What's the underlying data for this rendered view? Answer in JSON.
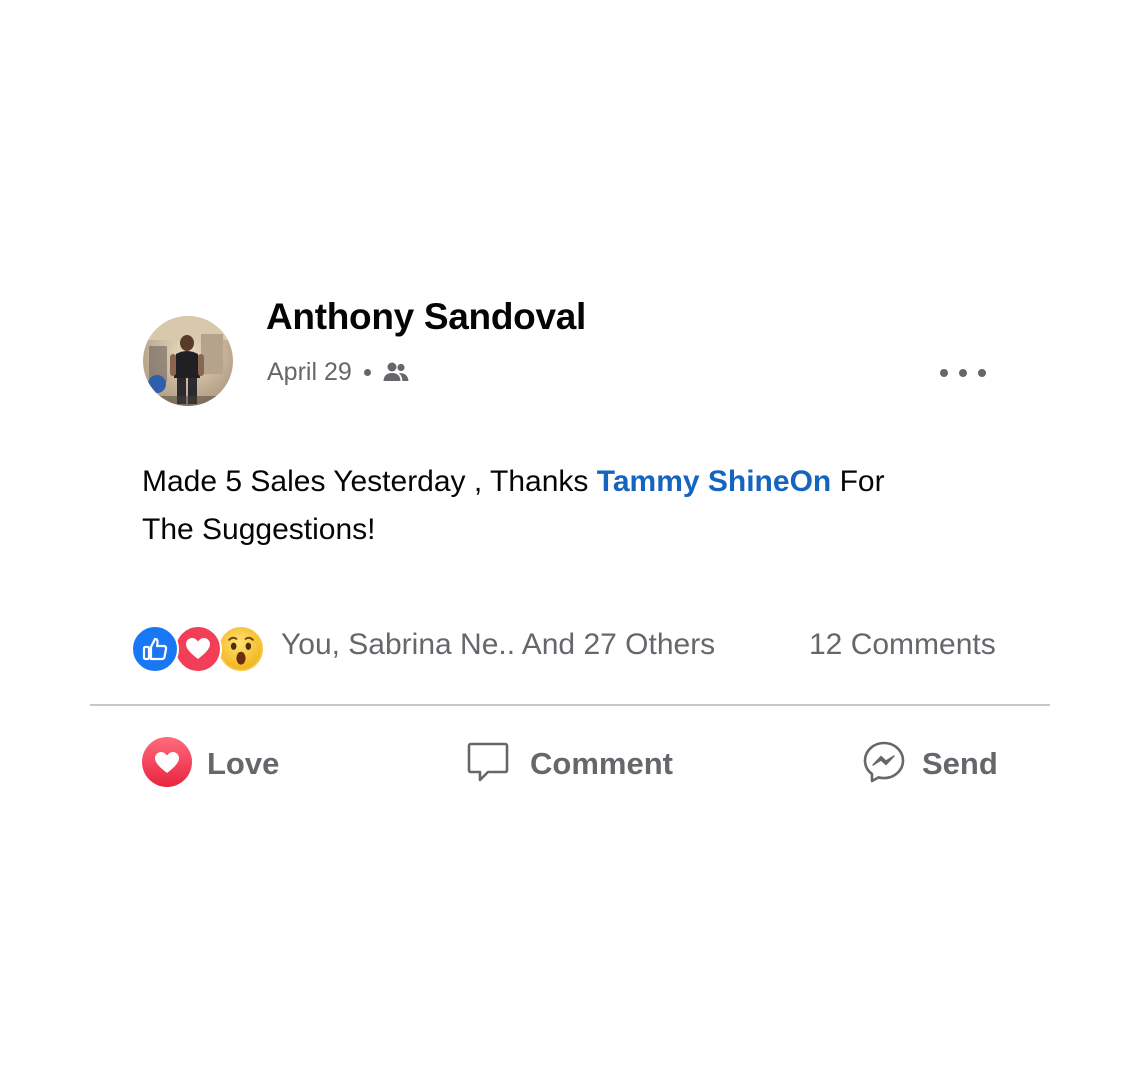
{
  "post": {
    "author": "Anthony Sandoval",
    "date": "April 29",
    "audience_icon": "friends-icon",
    "text_before": "Made 5 Sales Yesterday , Thanks ",
    "mention": "Tammy ShineOn",
    "text_after": " For The Suggestions!",
    "mention_color": "#1565c0"
  },
  "reactions": {
    "icons": [
      "like-icon",
      "love-icon",
      "wow-icon"
    ],
    "summary": "You, Sabrina Ne.. And 27 Others",
    "comments": "12 Comments"
  },
  "actions": {
    "love_label": "Love",
    "comment_label": "Comment",
    "send_label": "Send"
  },
  "colors": {
    "like": "#1877f2",
    "love": "#f33e58",
    "secondary_text": "#65676b"
  }
}
